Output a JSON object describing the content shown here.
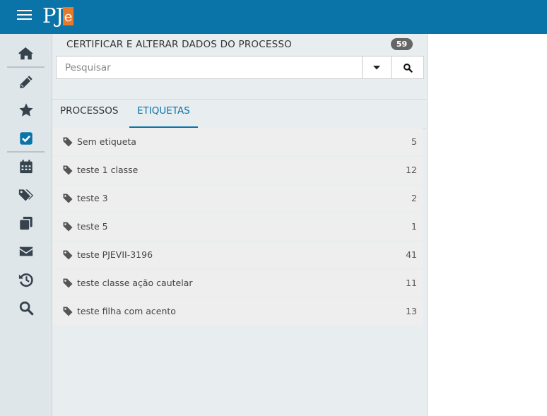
{
  "header": {
    "logo_text": "PJ",
    "logo_accent": "e",
    "brand_color": "#0a73a8",
    "accent_color": "#e8792b"
  },
  "sidebar": {
    "items": [
      {
        "icon": "home-icon"
      },
      {
        "icon": "pencil-icon"
      },
      {
        "icon": "star-icon"
      },
      {
        "icon": "checkbox-icon",
        "active": true
      },
      {
        "icon": "calendar-icon"
      },
      {
        "icon": "tags-icon"
      },
      {
        "icon": "copy-icon"
      },
      {
        "icon": "envelope-icon"
      },
      {
        "icon": "history-icon"
      },
      {
        "icon": "search-icon"
      }
    ]
  },
  "panel": {
    "title": "CERTIFICAR E ALTERAR DADOS DO PROCESSO",
    "count": "59",
    "search_placeholder": "Pesquisar",
    "tabs": [
      {
        "label": "PROCESSOS",
        "active": false
      },
      {
        "label": "ETIQUETAS",
        "active": true
      }
    ],
    "tags": [
      {
        "label": "Sem etiqueta",
        "count": "5"
      },
      {
        "label": "teste 1 classe",
        "count": "12"
      },
      {
        "label": "teste 3",
        "count": "2"
      },
      {
        "label": "teste 5",
        "count": "1"
      },
      {
        "label": "teste PJEVII-3196",
        "count": "41"
      },
      {
        "label": "teste classe ação cautelar",
        "count": "11"
      },
      {
        "label": "teste filha com acento",
        "count": "13"
      }
    ]
  }
}
